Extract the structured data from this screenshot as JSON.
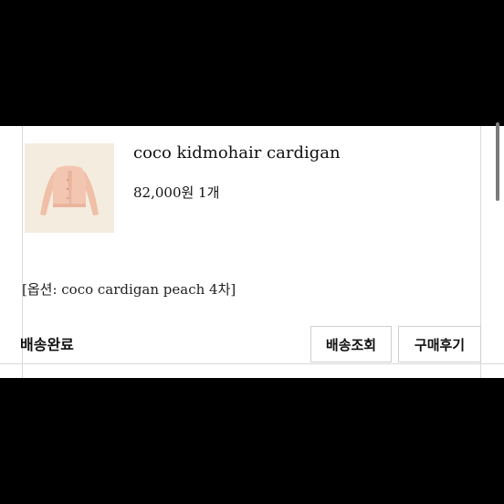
{
  "product": {
    "name": "coco kidmohair cardigan",
    "price_qty": "82,000원 1개",
    "option": "[옵션: coco cardigan peach 4차]",
    "image_alt": "peach cropped cardigan"
  },
  "order": {
    "status": "배송완료"
  },
  "actions": {
    "track_label": "배송조회",
    "review_label": "구매후기"
  },
  "colors": {
    "background": "#000000",
    "panel": "#ffffff",
    "thumb_bg": "#f4ecdf",
    "cardigan": "#f2c3ad"
  }
}
